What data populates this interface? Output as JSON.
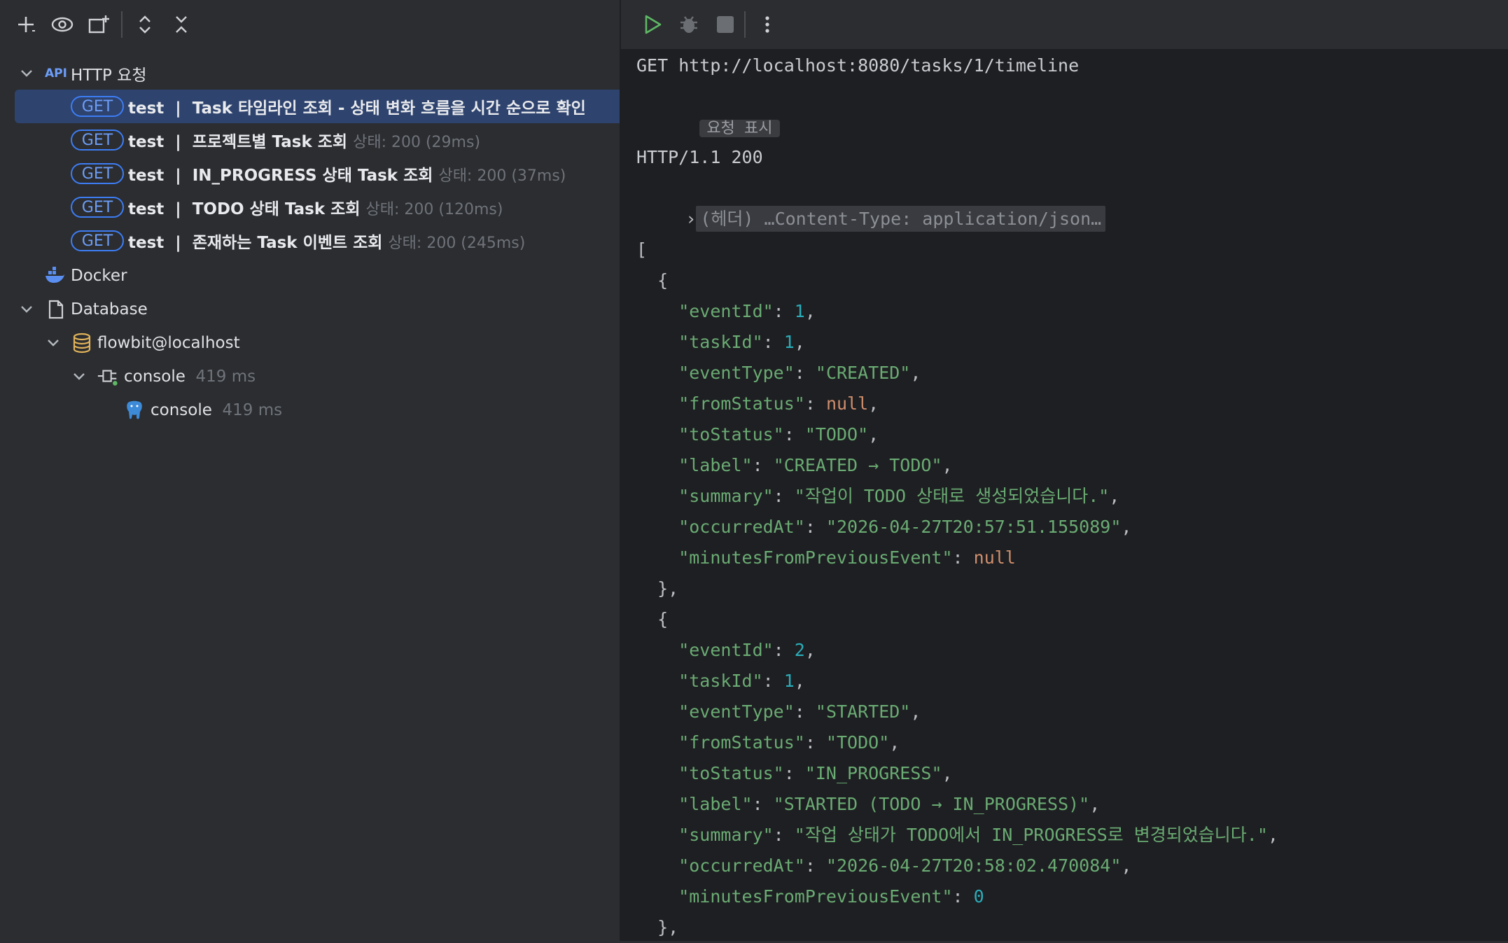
{
  "sidebar": {
    "toolbar": {
      "buttons": [
        {
          "name": "add-icon",
          "glyph": "+"
        },
        {
          "name": "eye-icon",
          "glyph": "◉"
        },
        {
          "name": "new-window-icon",
          "glyph": "⧉"
        },
        {
          "name": "expand-all-icon",
          "glyph": "⌃"
        },
        {
          "name": "collapse-all-icon",
          "glyph": "✕"
        }
      ]
    },
    "http_group": {
      "label": "HTTP 요청"
    },
    "requests": [
      {
        "method": "GET",
        "name": "test",
        "sep": "|",
        "title": "Task 타임라인 조회 - 상태 변화 흐름을 시간 순으로 확인",
        "status": ""
      },
      {
        "method": "GET",
        "name": "test",
        "sep": "|",
        "title": "프로젝트별 Task 조회",
        "status": "상태: 200 (29ms)"
      },
      {
        "method": "GET",
        "name": "test",
        "sep": "|",
        "title": "IN_PROGRESS 상태 Task 조회",
        "status": "상태: 200 (37ms)"
      },
      {
        "method": "GET",
        "name": "test",
        "sep": "|",
        "title": "TODO 상태 Task 조회",
        "status": "상태: 200 (120ms)"
      },
      {
        "method": "GET",
        "name": "test",
        "sep": "|",
        "title": "존재하는 Task 이벤트 조회",
        "status": "상태: 200 (245ms)"
      }
    ],
    "docker": {
      "label": "Docker"
    },
    "database": {
      "label": "Database",
      "datasource": "flowbit@localhost",
      "console": {
        "label": "console",
        "time": "419 ms"
      },
      "console_child": {
        "label": "console",
        "time": "419 ms"
      }
    }
  },
  "response": {
    "request_line": "GET http://localhost:8080/tasks/1/timeline",
    "show_request": "요청 표시",
    "status_line": "HTTP/1.1 200",
    "headers_summary": "(헤더) …Content-Type: application/json…",
    "events": [
      {
        "eventId": "1",
        "taskId": "1",
        "eventType": "\"CREATED\"",
        "fromStatus": "null",
        "toStatus": "\"TODO\"",
        "label": "\"CREATED → TODO\"",
        "summary": "\"작업이 TODO 상태로 생성되었습니다.\"",
        "occurredAt": "\"2026-04-27T20:57:51.155089\"",
        "minutesFromPreviousEvent": "null"
      },
      {
        "eventId": "2",
        "taskId": "1",
        "eventType": "\"STARTED\"",
        "fromStatus": "\"TODO\"",
        "toStatus": "\"IN_PROGRESS\"",
        "label": "\"STARTED (TODO → IN_PROGRESS)\"",
        "summary": "\"작업 상태가 TODO에서 IN_PROGRESS로 변경되었습니다.\"",
        "occurredAt": "\"2026-04-27T20:58:02.470084\"",
        "minutesFromPreviousEvent": "0"
      }
    ]
  }
}
